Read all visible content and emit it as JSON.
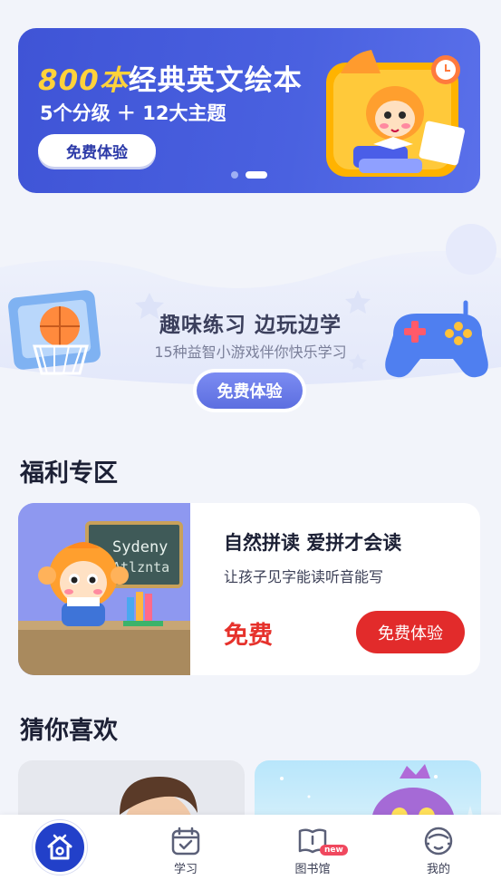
{
  "banner": {
    "title_num": "800本",
    "title_text": "经典英文绘本",
    "subtitle": "5个分级 ＋ 12大主题",
    "button": "免费体验",
    "dots_total": 2,
    "dots_active": 2
  },
  "game": {
    "title": "趣味练习  边玩边学",
    "subtitle": "15种益智小游戏伴你快乐学习",
    "button": "免费体验"
  },
  "welfare": {
    "section_title": "福利专区",
    "card": {
      "image_board_line1": "Sydeny",
      "image_board_line2": "Atlznta",
      "title": "自然拼读 爱拼才会读",
      "subtitle": "让孩子见字能读听音能写",
      "price": "免费",
      "button": "免费体验"
    }
  },
  "recommend": {
    "section_title": "猜你喜欢"
  },
  "tabbar": {
    "items": [
      {
        "label": "",
        "icon": "home-icon",
        "active": true
      },
      {
        "label": "学习",
        "icon": "calendar-check-icon"
      },
      {
        "label": "图书馆",
        "icon": "book-icon",
        "badge": "new"
      },
      {
        "label": "我的",
        "icon": "face-icon"
      }
    ]
  },
  "colors": {
    "primary": "#3f54d6",
    "accent_yellow": "#ffd23a",
    "price_red": "#e6322c",
    "button_red": "#e22b2b",
    "tab_active": "#2240c9"
  }
}
